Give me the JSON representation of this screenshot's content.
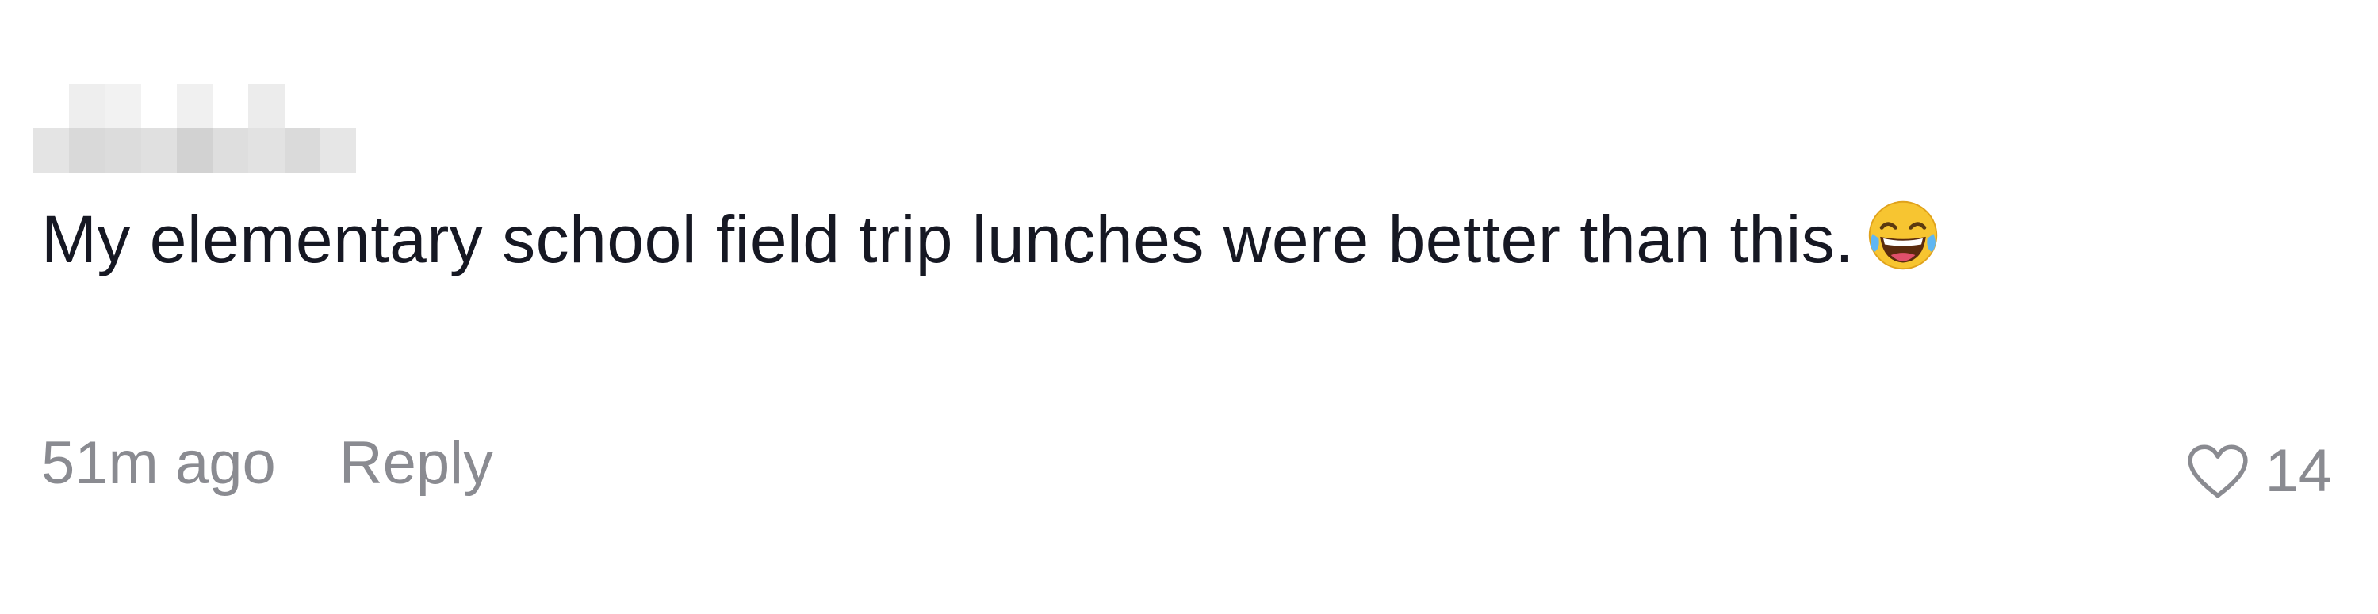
{
  "comment": {
    "username_redacted": true,
    "text": "My elementary school field trip lunches were better than this.",
    "emoji_icon": "face-with-tears-of-joy-icon",
    "timestamp": "51m ago",
    "reply_label": "Reply",
    "like_count": "14",
    "like_icon": "heart-outline-icon"
  },
  "colors": {
    "text_primary": "#161823",
    "text_secondary": "#8a8b91",
    "background": "#ffffff"
  }
}
